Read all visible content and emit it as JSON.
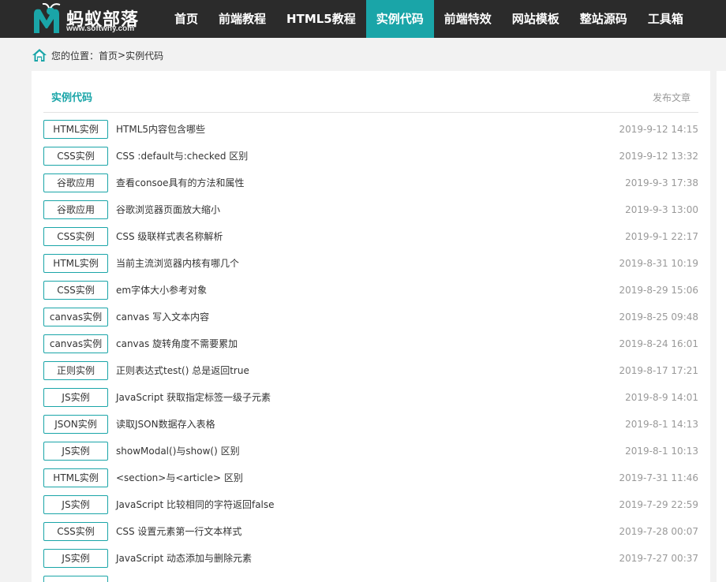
{
  "site": {
    "name": "蚂蚁部落",
    "url": "www.softwhy.com"
  },
  "nav": {
    "items": [
      "首页",
      "前端教程",
      "HTML5教程",
      "实例代码",
      "前端特效",
      "网站模板",
      "整站源码",
      "工具箱"
    ],
    "active": "实例代码"
  },
  "breadcrumb": {
    "prefix": "您的位置：",
    "home": "首页",
    "separator": ">",
    "current": "实例代码"
  },
  "section": {
    "title": "实例代码",
    "post_link": "发布文章"
  },
  "articles": [
    {
      "tag": "HTML实例",
      "title": "HTML5内容包含哪些",
      "date": "2019-9-12 14:15"
    },
    {
      "tag": "CSS实例",
      "title": "CSS :default与:checked 区别",
      "date": "2019-9-12 13:32"
    },
    {
      "tag": "谷歌应用",
      "title": "查看consoe具有的方法和属性",
      "date": "2019-9-3 17:38"
    },
    {
      "tag": "谷歌应用",
      "title": "谷歌浏览器页面放大缩小",
      "date": "2019-9-3 13:00"
    },
    {
      "tag": "CSS实例",
      "title": "CSS 级联样式表名称解析",
      "date": "2019-9-1 22:17"
    },
    {
      "tag": "HTML实例",
      "title": "当前主流浏览器内核有哪几个",
      "date": "2019-8-31 10:19"
    },
    {
      "tag": "CSS实例",
      "title": "em字体大小参考对象",
      "date": "2019-8-29 15:06"
    },
    {
      "tag": "canvas实例",
      "title": "canvas 写入文本内容",
      "date": "2019-8-25 09:48"
    },
    {
      "tag": "canvas实例",
      "title": "canvas 旋转角度不需要累加",
      "date": "2019-8-24 16:01"
    },
    {
      "tag": "正则实例",
      "title": "正则表达式test() 总是返回true",
      "date": "2019-8-17 17:21"
    },
    {
      "tag": "JS实例",
      "title": "JavaScript 获取指定标签一级子元素",
      "date": "2019-8-9 14:01"
    },
    {
      "tag": "JSON实例",
      "title": "读取JSON数据存入表格",
      "date": "2019-8-1 14:13"
    },
    {
      "tag": "JS实例",
      "title": "showModal()与show() 区别",
      "date": "2019-8-1 10:13"
    },
    {
      "tag": "HTML实例",
      "title": "<section>与<article> 区别",
      "date": "2019-7-31 11:46"
    },
    {
      "tag": "JS实例",
      "title": "JavaScript 比较相同的字符返回false",
      "date": "2019-7-29 22:59"
    },
    {
      "tag": "CSS实例",
      "title": "CSS 设置元素第一行文本样式",
      "date": "2019-7-28 00:07"
    },
    {
      "tag": "JS实例",
      "title": "JavaScript 动态添加与删除元素",
      "date": "2019-7-27 00:37"
    },
    {
      "tag": "",
      "title": "",
      "date": ""
    }
  ]
}
